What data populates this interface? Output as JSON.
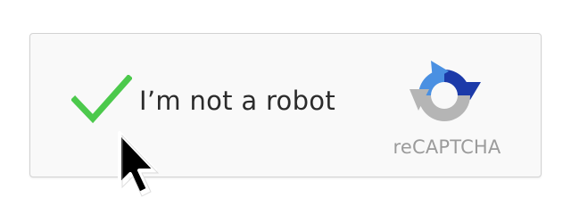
{
  "widget": {
    "label": "I’m not a robot",
    "checked": true,
    "brand": "reCAPTCHA"
  },
  "icons": {
    "checkbox": "checkmark-icon",
    "logo": "recaptcha-logo-icon",
    "cursor": "mouse-pointer-icon"
  },
  "colors": {
    "checkmark": "#4cc94c",
    "logo_blue_dark": "#1c3aa9",
    "logo_blue": "#4a90e2",
    "logo_gray": "#b5b5b5",
    "brand_text": "#9b9b9b"
  }
}
